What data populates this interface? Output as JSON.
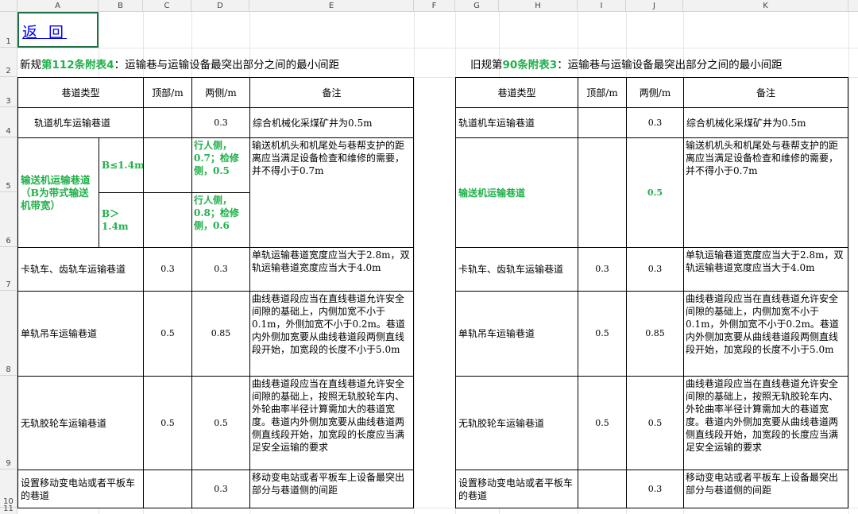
{
  "columns": [
    "A",
    "B",
    "C",
    "D",
    "E",
    "F",
    "G",
    "H",
    "I",
    "J",
    "K"
  ],
  "rows": [
    "1",
    "2",
    "3",
    "4",
    "5",
    "6",
    "7",
    "8",
    "9",
    "10",
    "11"
  ],
  "back_link": "返 回",
  "new_title": {
    "prefix": "新规",
    "highlight": "第112条附表4",
    "suffix": "：运输巷与运输设备最突出部分之间的最小间距"
  },
  "old_title": {
    "prefix": "旧规第",
    "highlight": "90条附表3",
    "suffix": "：运输巷与运输设备最突出部分之间的最小间距"
  },
  "headers": {
    "type": "巷道类型",
    "top": "顶部/m",
    "side": "两侧/m",
    "note": "备注"
  },
  "new_table": {
    "rail": {
      "type": "轨道机车运输巷道",
      "top": "",
      "side": "0.3",
      "note": "综合机械化采煤矿井为0.5m"
    },
    "conveyor": {
      "type": "输送机运输巷道（B为带式输送机带宽）",
      "sub1": {
        "cond": "B≤1.4m",
        "side": "行人侧，0.7；检修侧，0.5"
      },
      "sub2": {
        "cond": "B＞1.4m",
        "side": "行人侧，0.8；检修侧，0.6"
      },
      "note": "输送机机头和机尾处与巷帮支护的距离应当满足设备检查和维修的需要，并不得小于0.7m"
    },
    "track": {
      "type": "卡轨车、齿轨车运输巷道",
      "top": "0.3",
      "side": "0.3",
      "note": "单轨运输巷道宽度应当大于2.8m，双轨运输巷道宽度应当大于4.0m"
    },
    "monorail": {
      "type": "单轨吊车运输巷道",
      "top": "0.5",
      "side": "0.85",
      "note": "曲线巷道段应当在直线巷道允许安全间隙的基础上，内侧加宽不小于0.1m，外侧加宽不小于0.2m。巷道内外侧加宽要从曲线巷道段两侧直线段开始，加宽段的长度不小于5.0m"
    },
    "trackless": {
      "type": "无轨胶轮车运输巷道",
      "top": "0.5",
      "side": "0.5",
      "note": "曲线巷道段应当在直线巷道允许安全间隙的基础上，按照无轨胶轮车内、外轮曲率半径计算需加大的巷道宽度。巷道内外侧加宽要从曲线巷道两侧直线段开始，加宽段的长度应当满足安全运输的要求"
    },
    "substation": {
      "type": "设置移动变电站或者平板车的巷道",
      "top": "",
      "side": "0.3",
      "note": "移动变电站或者平板车上设备最突出部分与巷道侧的间距"
    }
  },
  "old_table": {
    "rail": {
      "type": "轨道机车运输巷道",
      "top": "",
      "side": "0.3",
      "note": "综合机械化采煤矿井为0.5m"
    },
    "conveyor": {
      "type": "输送机运输巷道",
      "top": "",
      "side": "0.5",
      "note": "输送机机头和机尾处与巷帮支护的距离应当满足设备检查和维修的需要，并不得小于0.7m"
    },
    "track": {
      "type": "卡轨车、齿轨车运输巷道",
      "top": "0.3",
      "side": "0.3",
      "note": "单轨运输巷道宽度应当大于2.8m，双轨运输巷道宽度应当大于4.0m"
    },
    "monorail": {
      "type": "单轨吊车运输巷道",
      "top": "0.5",
      "side": "0.85",
      "note": "曲线巷道段应当在直线巷道允许安全间隙的基础上，内侧加宽不小于0.1m，外侧加宽不小于0.2m。巷道内外侧加宽要从曲线巷道段两侧直线段开始，加宽段的长度不小于5.0m"
    },
    "trackless": {
      "type": "无轨胶轮车运输巷道",
      "top": "0.5",
      "side": "0.5",
      "note": "曲线巷道段应当在直线巷道允许安全间隙的基础上，按照无轨胶轮车内、外轮曲率半径计算需加大的巷道宽度。巷道内外侧加宽要从曲线巷道两侧直线段开始，加宽段的长度应当满足安全运输的要求"
    },
    "substation": {
      "type": "设置移动变电站或者平板车的巷道",
      "top": "",
      "side": "0.3",
      "note": "移动变电站或者平板车上设备最突出部分与巷道侧的间距"
    }
  },
  "colors": {
    "highlight": "#21b04b",
    "link": "#0000ee",
    "selection": "#1e7145"
  }
}
